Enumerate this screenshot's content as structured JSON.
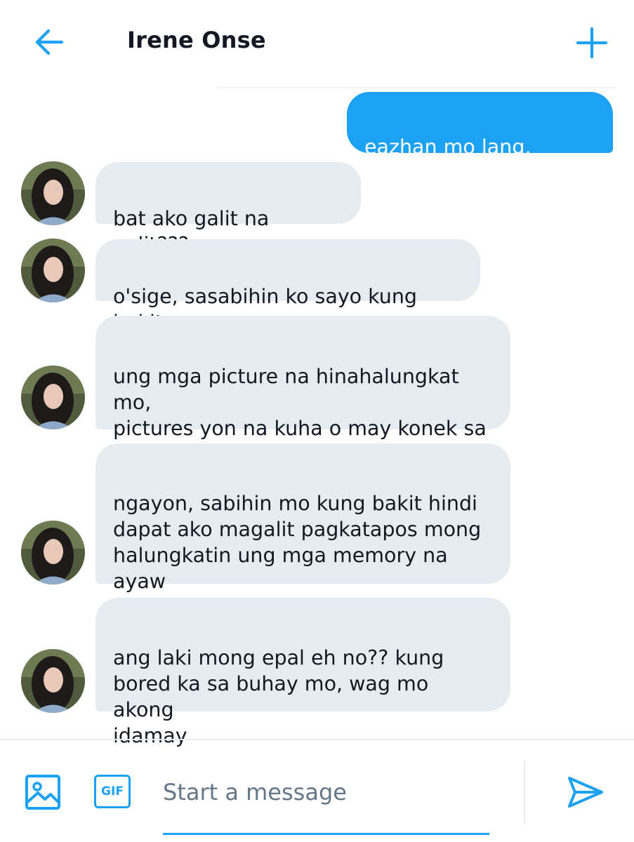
{
  "header": {
    "title": "Irene Onse",
    "back_icon": "arrow-left-icon",
    "new_icon": "plus-icon",
    "accent": "#1da1f2"
  },
  "messages": [
    {
      "side": "out",
      "text": "eazhan mo lang, eleven"
    },
    {
      "side": "in",
      "text": "bat ako galit na galit???"
    },
    {
      "side": "in",
      "text": "o'sige, sasabihin ko sayo kung bakit"
    },
    {
      "side": "in",
      "text": "ung mga picture na hinahalungkat mo,\npictures yon na kuha o may konek sa\ngago kong ex"
    },
    {
      "side": "in",
      "text": "ngayon, sabihin mo kung bakit hindi\ndapat ako magalit pagkatapos mong\nhalungkatin ung mga memory na ayaw\nko ng balikan o miski makita"
    },
    {
      "side": "in",
      "text": "ang laki mong epal eh no?? kung\nbored ka sa buhay mo, wag mo akong\nidamay"
    }
  ],
  "composer": {
    "image_icon": "image-icon",
    "gif_label": "GIF",
    "placeholder": "Start a message",
    "value": "",
    "send_icon": "send-icon"
  },
  "colors": {
    "outgoing_bubble": "#1da1f2",
    "incoming_bubble": "#e6ecf0",
    "text": "#141823",
    "placeholder": "#657786"
  }
}
